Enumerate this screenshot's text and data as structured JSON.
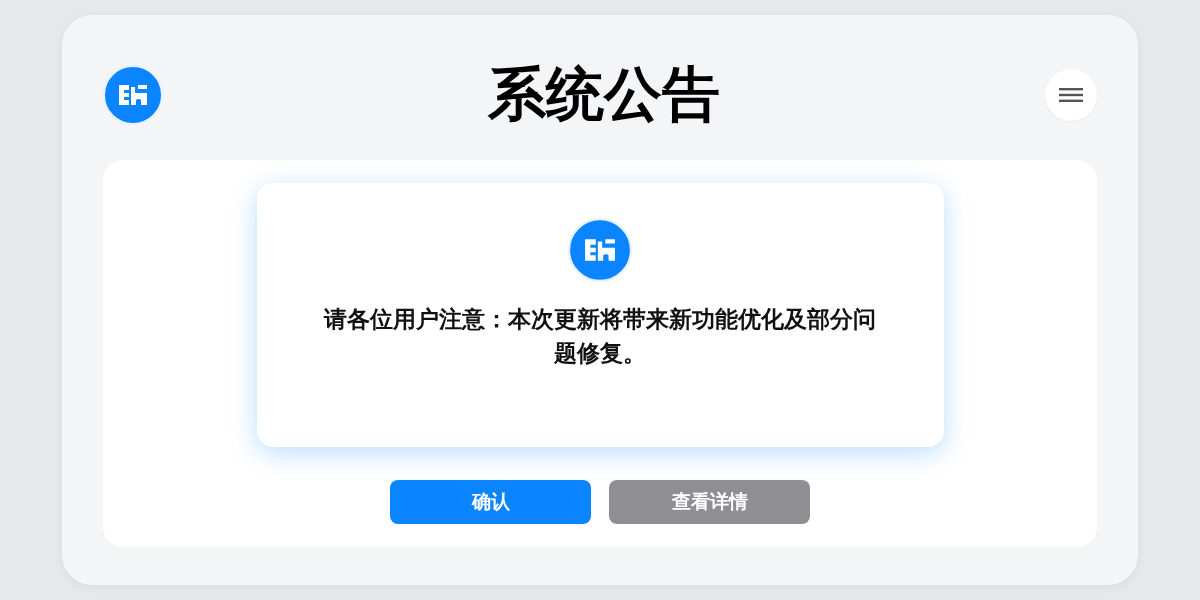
{
  "title": "系统公告",
  "notice": {
    "message": "请各位用户注意：本次更新将带来新功能优化及部分问题修复。"
  },
  "buttons": [
    {
      "label": "确认",
      "kind": "primary"
    },
    {
      "label": "查看详情",
      "kind": "secondary"
    }
  ]
}
